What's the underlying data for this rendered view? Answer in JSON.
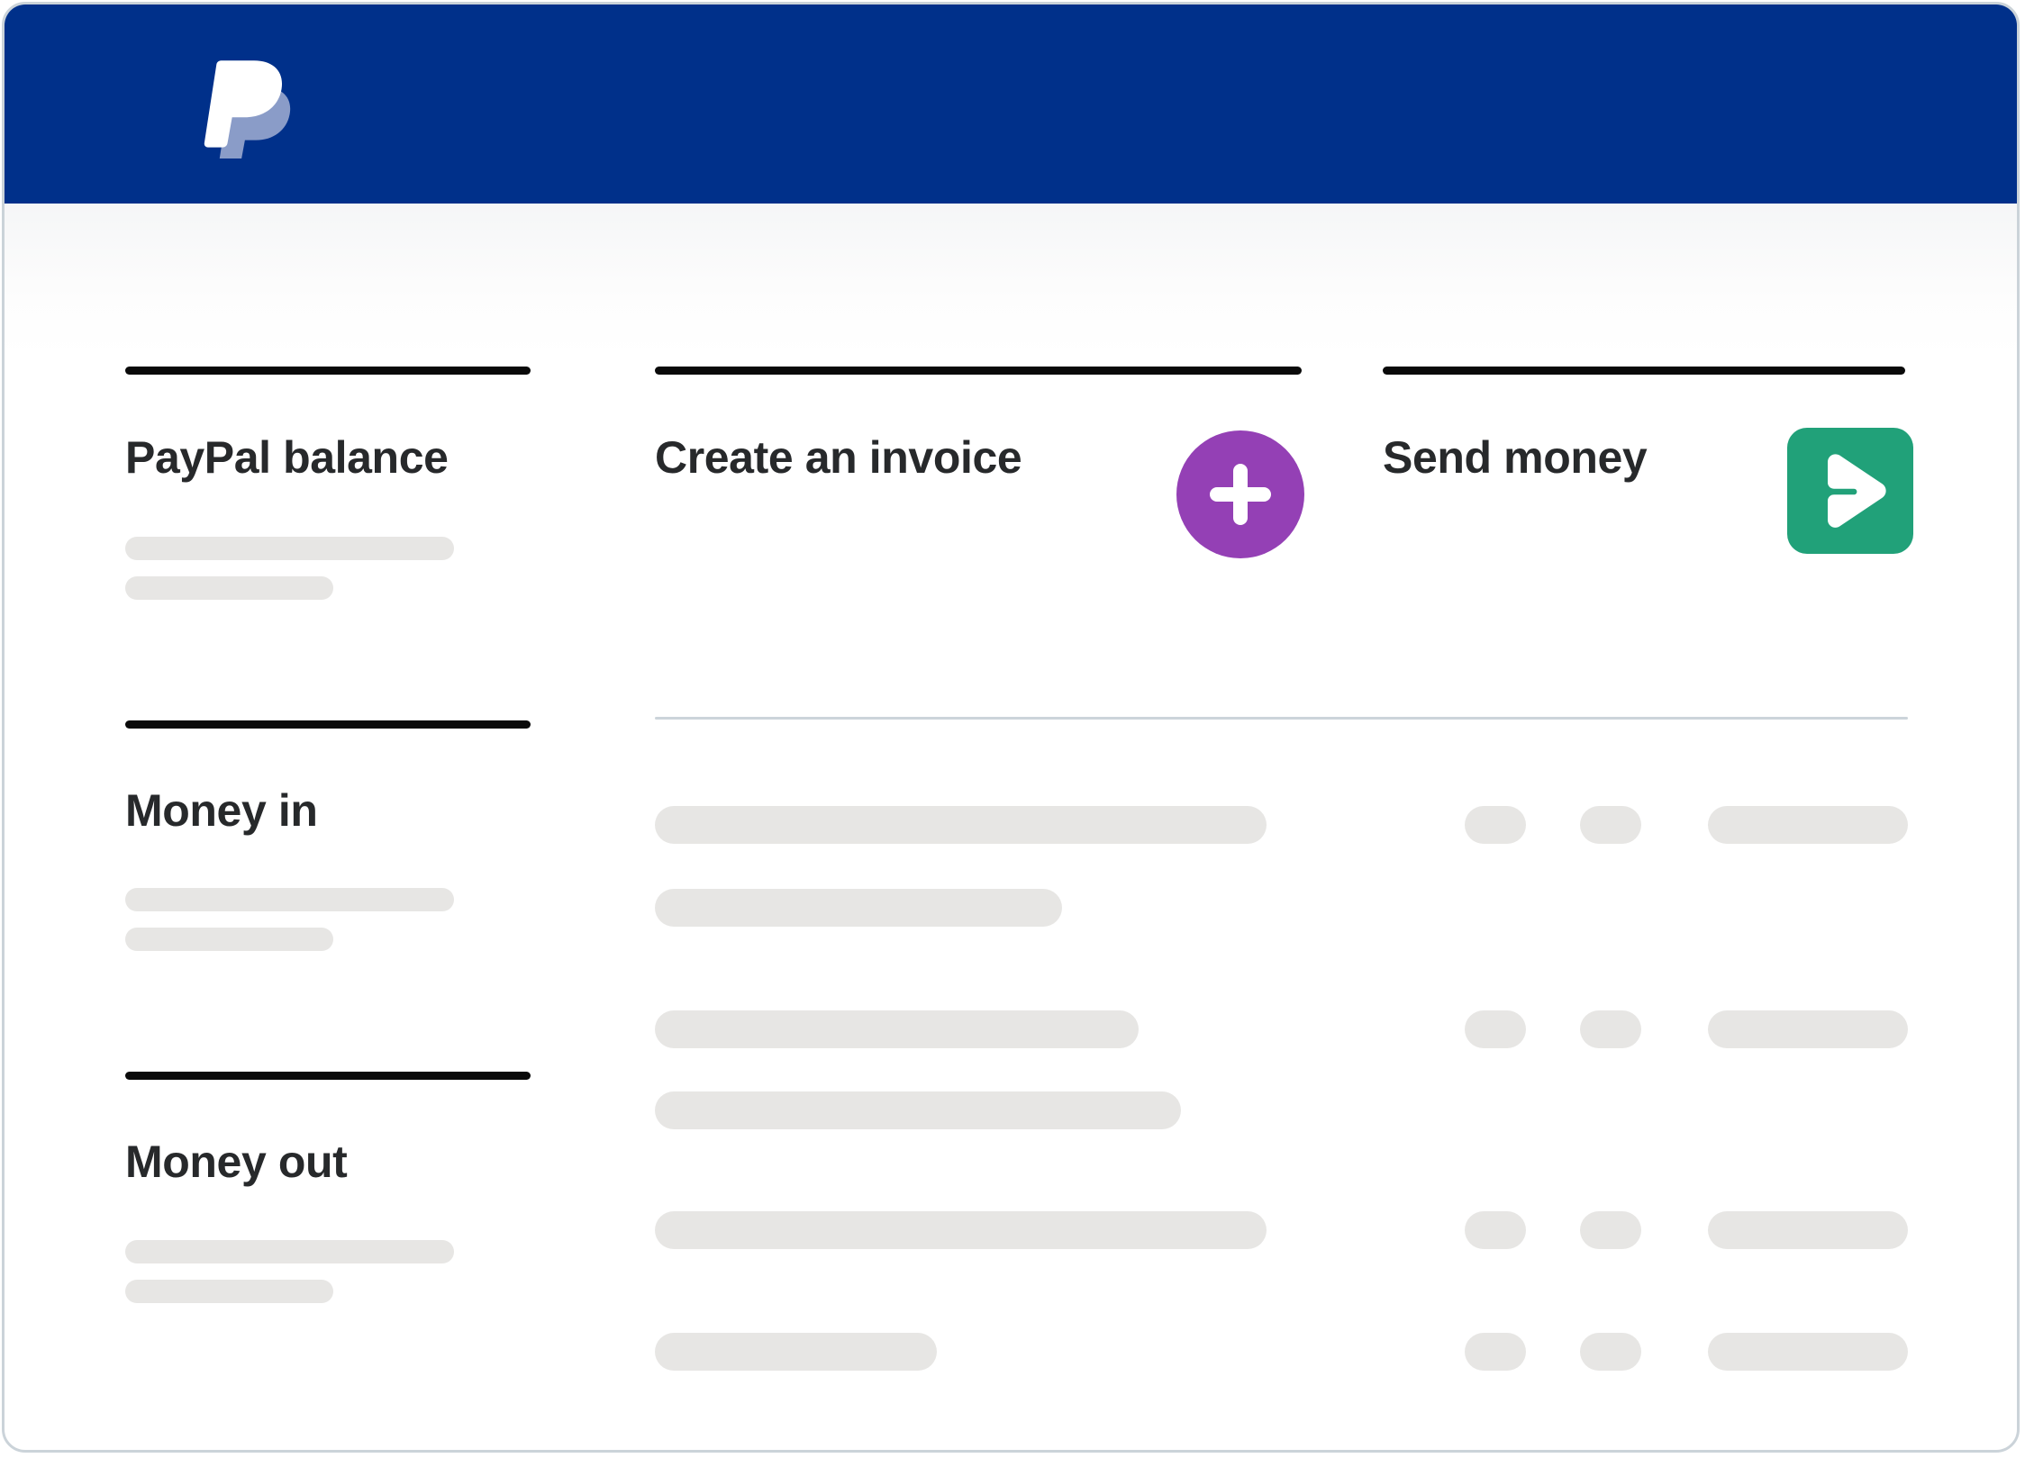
{
  "card": {
    "border_color": "#cbd3d9",
    "background": "#ffffff"
  },
  "header": {
    "background_color": "#00308a",
    "logo_name": "paypal-logo",
    "logo_front_color": "#ffffff",
    "logo_back_color": "#8a9cc8"
  },
  "panels": {
    "balance": {
      "title": "PayPal balance",
      "skeleton_widths": [
        255,
        161
      ]
    },
    "money_in": {
      "title": "Money in",
      "skeleton_widths": [
        255,
        161
      ]
    },
    "money_out": {
      "title": "Money out",
      "skeleton_widths": [
        255,
        161
      ]
    },
    "invoice": {
      "title": "Create an invoice",
      "button_name": "plus-icon",
      "button_color": "#9440b5",
      "icon_color": "#ffffff"
    },
    "send": {
      "title": "Send money",
      "button_name": "send-icon",
      "button_color": "#21a179",
      "icon_color": "#ffffff"
    }
  },
  "transactions": {
    "divider_color": "#ccd4da",
    "skeleton_color": "#e7e6e4",
    "rows": [
      {
        "primary_width": 679,
        "secondary_width": 452,
        "tags": [
          68,
          68,
          222
        ]
      },
      {
        "primary_width": 537,
        "secondary_width": 584,
        "tags": [
          68,
          68,
          222
        ]
      },
      {
        "primary_width": 679,
        "secondary_width": 0,
        "tags": [
          68,
          68,
          222
        ]
      },
      {
        "primary_width": 313,
        "secondary_width": 0,
        "tags": [
          68,
          68,
          222
        ]
      }
    ]
  }
}
